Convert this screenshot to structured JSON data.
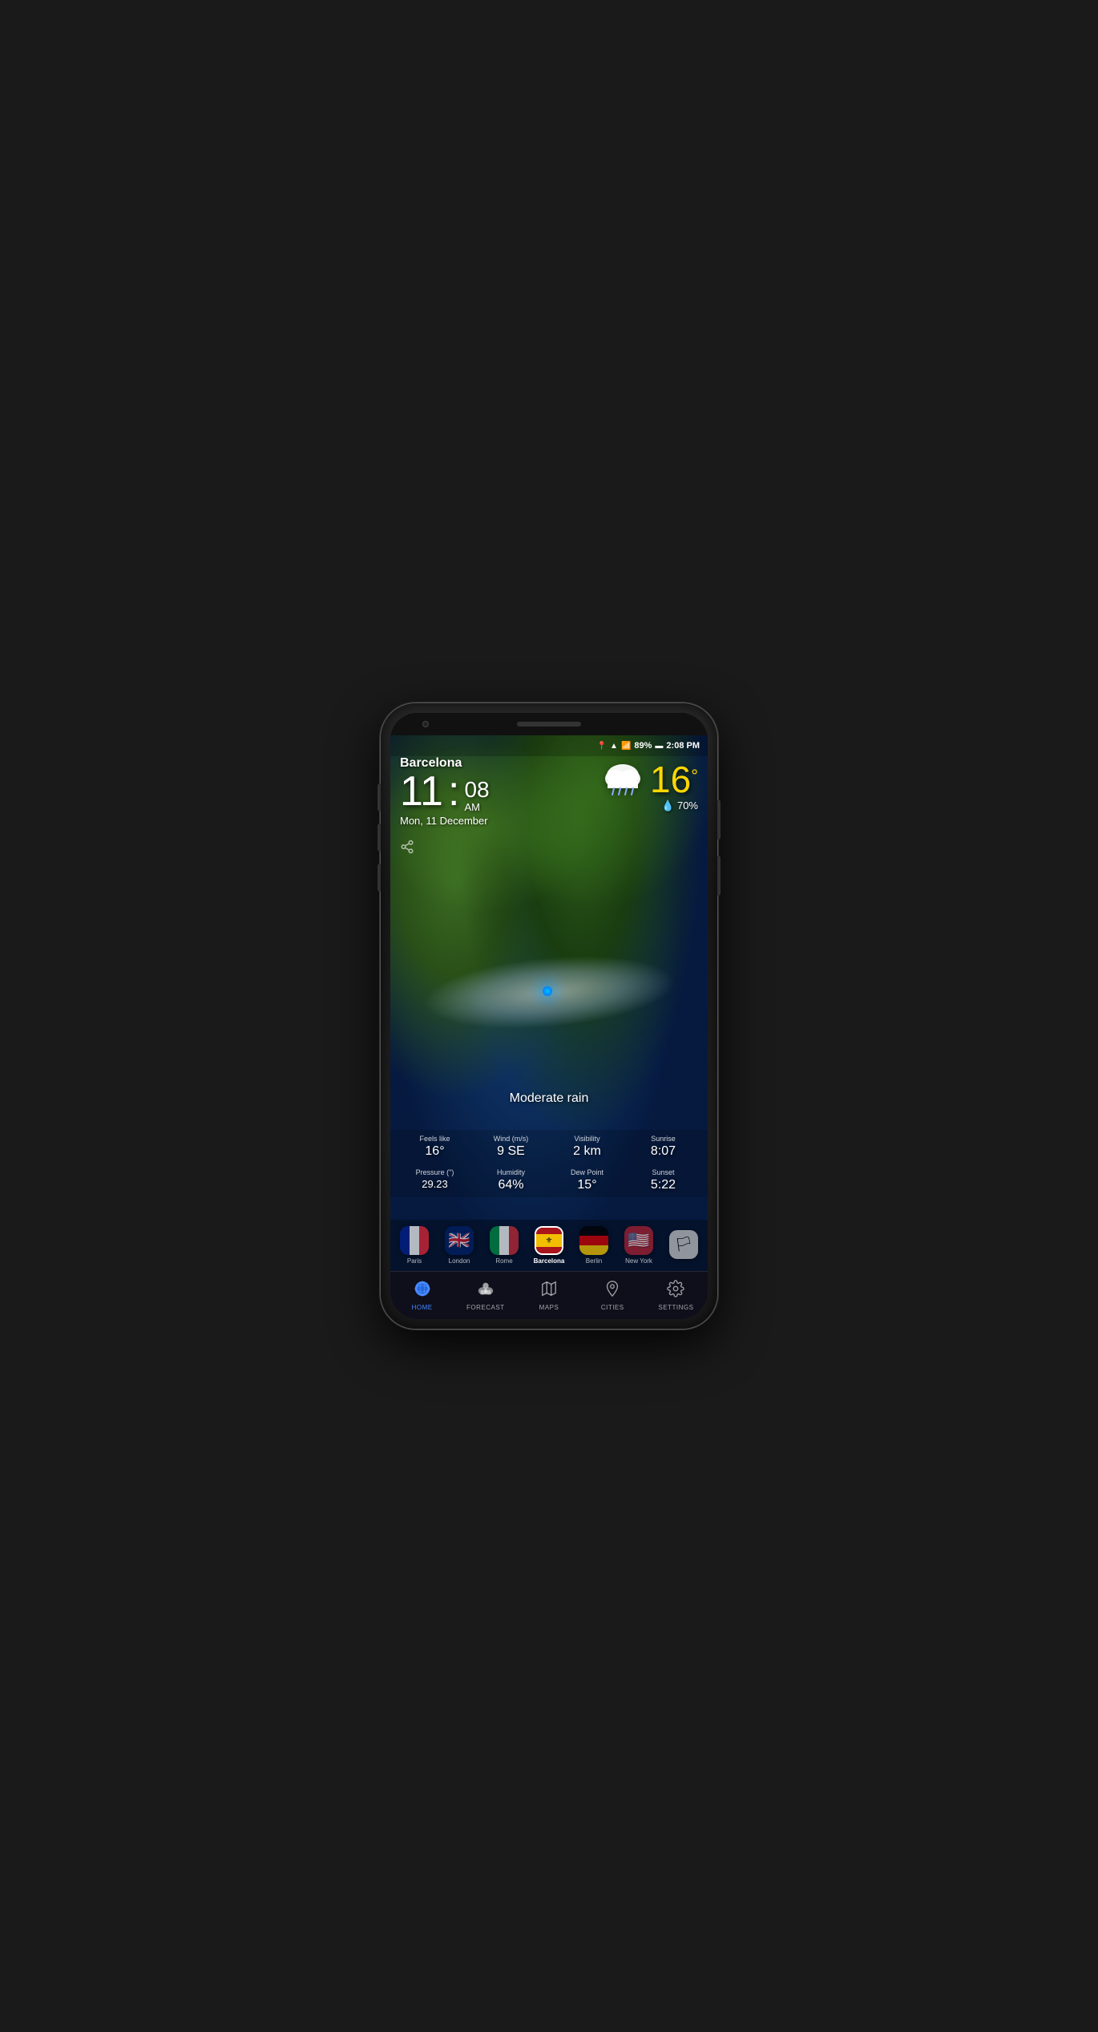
{
  "phone": {
    "status_bar": {
      "location_icon": "📍",
      "wifi_icon": "wifi",
      "signal_icon": "signal",
      "battery_percent": "89%",
      "battery_icon": "🔋",
      "time": "2:08 PM"
    },
    "weather": {
      "city": "Barcelona",
      "time_hour": "11",
      "time_minutes": "08",
      "time_ampm": "AM",
      "date": "Mon, 11 December",
      "temperature": "16°",
      "condition": "Moderate rain",
      "humidity_label": "💧",
      "humidity_percent": "70%",
      "feels_like_label": "Feels like",
      "feels_like_value": "16°",
      "wind_label": "Wind (m/s)",
      "wind_value": "9 SE",
      "visibility_label": "Visibility",
      "visibility_value": "2 km",
      "sunrise_label": "Sunrise",
      "sunrise_value": "8:07",
      "pressure_label": "Pressure (\")",
      "pressure_value": "29.23",
      "humidity_stat_label": "Humidity",
      "humidity_stat_value": "64%",
      "dew_point_label": "Dew Point",
      "dew_point_value": "15°",
      "sunset_label": "Sunset",
      "sunset_value": "5:22"
    },
    "cities": [
      {
        "id": "paris",
        "label": "Paris",
        "active": false,
        "flag": "fr"
      },
      {
        "id": "london",
        "label": "London",
        "active": false,
        "flag": "uk"
      },
      {
        "id": "rome",
        "label": "Rome",
        "active": false,
        "flag": "it"
      },
      {
        "id": "barcelona",
        "label": "Barcelona",
        "active": true,
        "flag": "es"
      },
      {
        "id": "berlin",
        "label": "Berlin",
        "active": false,
        "flag": "de"
      },
      {
        "id": "new-york",
        "label": "New York",
        "active": false,
        "flag": "us"
      },
      {
        "id": "other",
        "label": "",
        "active": false,
        "flag": "other"
      }
    ],
    "nav": [
      {
        "id": "home",
        "label": "HOME",
        "icon": "🌐",
        "active": true
      },
      {
        "id": "forecast",
        "label": "FORECAST",
        "icon": "⛅",
        "active": false
      },
      {
        "id": "maps",
        "label": "MAPS",
        "icon": "🗺",
        "active": false
      },
      {
        "id": "cities",
        "label": "CITIES",
        "icon": "📍",
        "active": false
      },
      {
        "id": "settings",
        "label": "SETTINGS",
        "icon": "⚙",
        "active": false
      }
    ]
  }
}
